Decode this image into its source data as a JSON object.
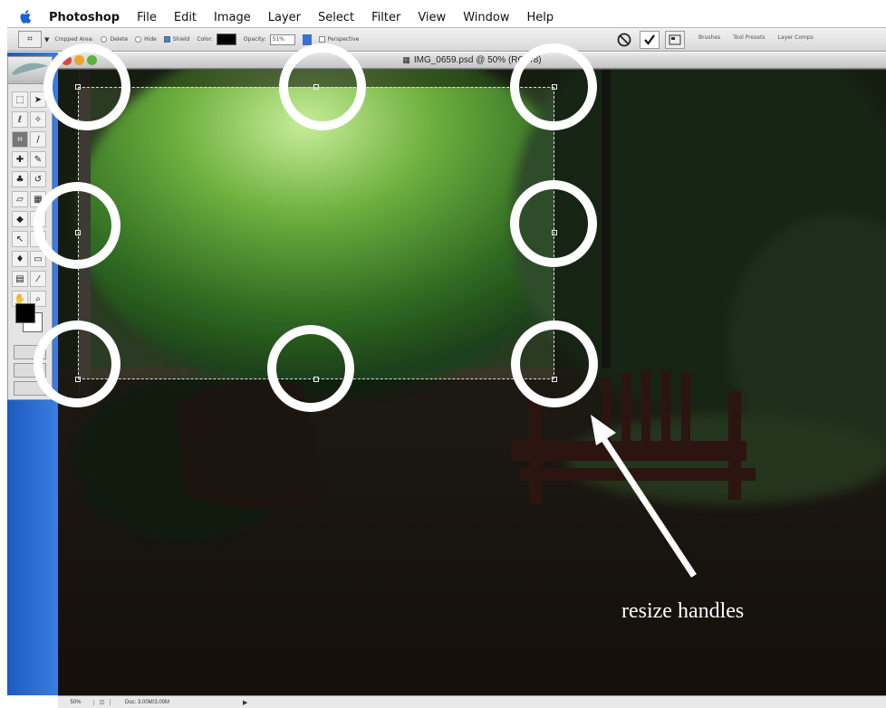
{
  "menubar": {
    "app_name": "Photoshop",
    "items": [
      "File",
      "Edit",
      "Image",
      "Layer",
      "Select",
      "Filter",
      "View",
      "Window",
      "Help"
    ]
  },
  "options_bar": {
    "cropped_area_label": "Cropped Area:",
    "delete_label": "Delete",
    "hide_label": "Hide",
    "shield_label": "Shield",
    "color_label": "Color:",
    "opacity_label": "Opacity:",
    "opacity_value": "51%",
    "perspective_label": "Perspective",
    "palette_well_tabs": [
      "Brushes",
      "Tool Presets",
      "Layer Comps"
    ]
  },
  "document": {
    "title": "IMG_0659.psd @ 50% (RGB/8)"
  },
  "status_bar": {
    "zoom": "50%",
    "doc_info": "Doc: 3.00M/3.00M"
  },
  "annotation": {
    "label": "resize handles"
  },
  "colors": {
    "annotation": "#ffffff",
    "desktop_blue": "#2a6bd0",
    "foreground_swatch": "#000000"
  }
}
